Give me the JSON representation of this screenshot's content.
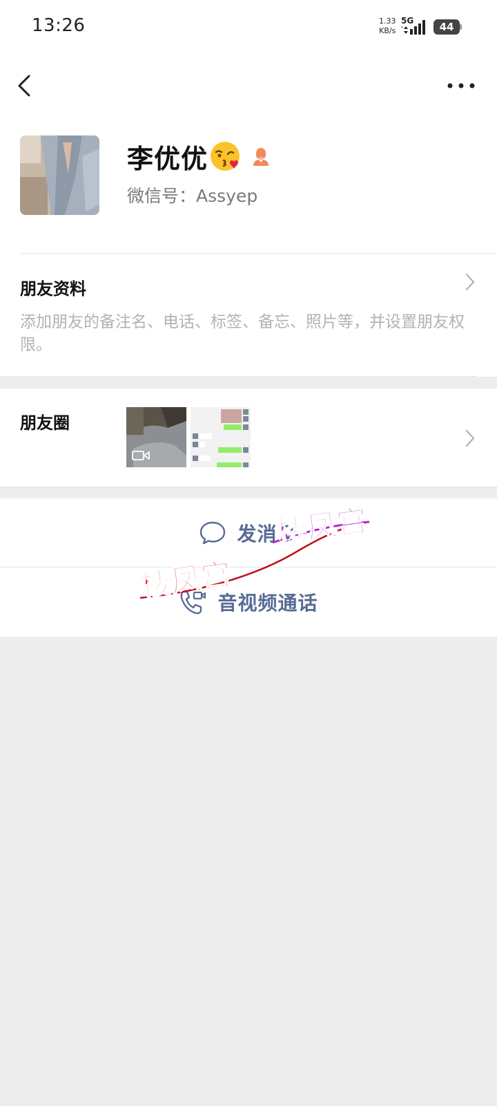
{
  "status_bar": {
    "time": "13:26",
    "net_speed_value": "1.33",
    "net_speed_unit": "KB/s",
    "network": "5G",
    "battery": "44"
  },
  "nav": {
    "back_icon": "chevron-left-icon",
    "more_icon": "more-dots-icon"
  },
  "profile": {
    "name": "李优优",
    "name_emoji": "kissing-face-emoji",
    "gender_icon": "female-icon",
    "wechat_id": "微信号：Assyep"
  },
  "friend_info": {
    "title": "朋友资料",
    "description": "添加朋友的备注名、电话、标签、备忘、照片等，并设置朋友权限。"
  },
  "moments": {
    "title": "朋友圈",
    "thumbnails": [
      "video-thumbnail",
      "chat-screenshot-thumbnail"
    ]
  },
  "actions": {
    "message_label": "发消息",
    "call_label": "音视频通话"
  },
  "watermark": {
    "text": "楼凤宫"
  },
  "colors": {
    "link": "#576b95",
    "background": "#ededed",
    "hint": "#b2b2b2",
    "watermark_red": "#e8192c",
    "watermark_purple": "#c21fd6"
  }
}
